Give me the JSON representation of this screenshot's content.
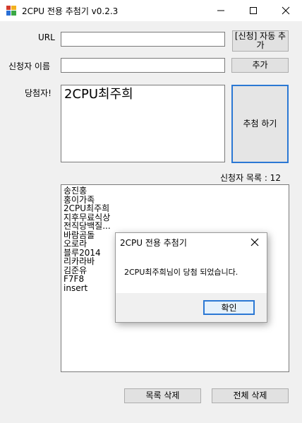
{
  "window": {
    "title": "2CPU 전용 추첨기 v0.2.3",
    "icon": "app-icon"
  },
  "form": {
    "url_label": "URL",
    "url_value": "",
    "applicant_label": "신청자 이름",
    "applicant_value": "",
    "auto_add_button": "[신청] 자동 추가",
    "add_button": "추가",
    "winner_label": "당첨자!",
    "winner_value": "2CPU최주희",
    "draw_button": "추첨 하기",
    "count_label": "신청자 목록 : 12"
  },
  "list": {
    "items": [
      "송진홍",
      "홍이가족",
      "2CPU최주희",
      "지후무료식상",
      "전직당백질...",
      "바람곰돌",
      "오로라",
      "블루2014",
      "리카라바",
      "김준유",
      "F7F8",
      "insert"
    ]
  },
  "buttons": {
    "delete_item": "목록 삭제",
    "delete_all": "전체 삭제"
  },
  "dialog": {
    "title": "2CPU 전용 추첨기",
    "message": "2CPU최주희님이 당첨 되었습니다.",
    "ok": "확인"
  }
}
